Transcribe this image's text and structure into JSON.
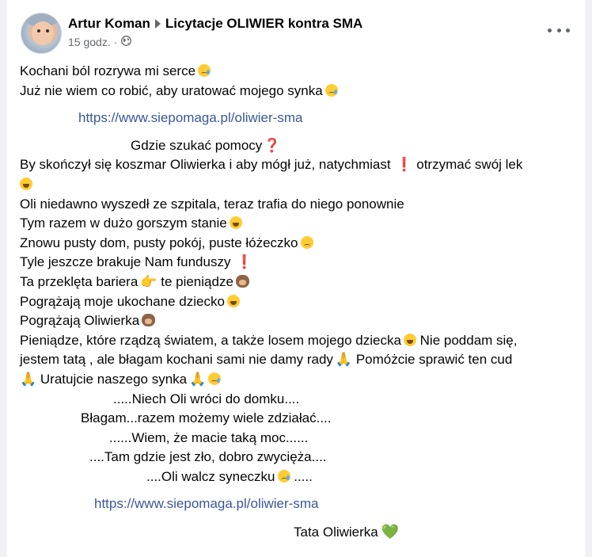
{
  "post": {
    "author": "Artur Koman",
    "group": "Licytacje OLIWIER kontra SMA",
    "time": "15 godz.",
    "separator": "·",
    "privacy_icon": "globe-icon",
    "more_icon": "more-options-icon"
  },
  "body": {
    "l1": "Kochani ból rozrywa mi serce",
    "l2": "Już nie wiem co robić, aby uratować mojego synka",
    "link1": "https://www.siepomaga.pl/oliwier-sma",
    "l3": "Gdzie szukać pomocy",
    "l4a": "By skończył się koszmar Oliwierka i aby mógł już, natychmiast",
    "l4b": "otrzymać swój lek",
    "l5": "Oli niedawno wyszedł ze szpitala,  teraz trafia do niego ponownie",
    "l6": "Tym razem w dużo gorszym stanie",
    "l7": "Znowu pusty dom, pusty pokój, puste łóżeczko",
    "l8": "Tyle jeszcze brakuje Nam funduszy",
    "l9a": "Ta przeklęta bariera",
    "l9b": "te pieniądze",
    "l10": "Pogrążają  moje ukochane dziecko",
    "l11": "Pogrążają Oliwierka",
    "l12a": "Pieniądze, które rządzą światem, a także losem mojego dziecka",
    "l12b": "Nie poddam się,",
    "l13a": "jestem tatą , ale błagam kochani sami nie damy rady",
    "l13b": "Pomóżcie sprawić ten cud",
    "l14": "Uratujcie naszego synka",
    "l15": ".....Niech Oli wróci do domku....",
    "l16": "Błagam...razem możemy wiele zdziałać....",
    "l17": "......Wiem, że macie taką moc......",
    "l18": "....Tam gdzie jest zło, dobro zwycięża....",
    "l19a": "....Oli walcz syneczku",
    "l19b": ".....",
    "link2": "https://www.siepomaga.pl/oliwier-sma",
    "l20": "Tata Oliwierka"
  },
  "emoji": {
    "exclamation": "❗",
    "question": "❓",
    "point": "👉",
    "pray": "🙏",
    "heart": "💚"
  }
}
